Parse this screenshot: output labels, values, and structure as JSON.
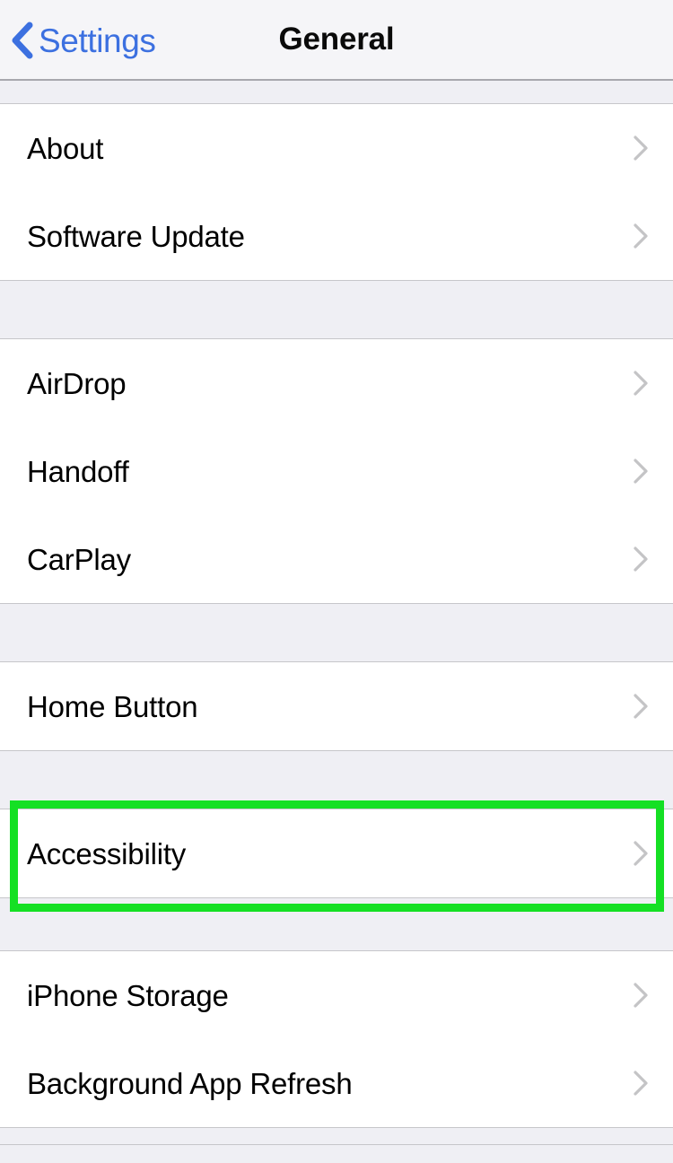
{
  "navbar": {
    "back_label": "Settings",
    "back_icon": "chevron-left-icon",
    "title": "General"
  },
  "colors": {
    "accent_blue": "#3C70E0",
    "highlight_green": "#15E024",
    "group_background": "#FFFFFF",
    "page_background": "#EFEFF4",
    "separator": "#C6C6CA",
    "chevron_gray": "#C4C4C6",
    "label_black": "#000000"
  },
  "sections": [
    {
      "gap_height": 26,
      "first": true,
      "rows": [
        {
          "label": "About",
          "accessory": "chevron-right-icon",
          "highlighted": false
        },
        {
          "label": "Software Update",
          "accessory": "chevron-right-icon",
          "highlighted": false
        }
      ]
    },
    {
      "gap_height": 66,
      "first": false,
      "rows": [
        {
          "label": "AirDrop",
          "accessory": "chevron-right-icon",
          "highlighted": false
        },
        {
          "label": "Handoff",
          "accessory": "chevron-right-icon",
          "highlighted": false
        },
        {
          "label": "CarPlay",
          "accessory": "chevron-right-icon",
          "highlighted": false
        }
      ]
    },
    {
      "gap_height": 66,
      "first": false,
      "rows": [
        {
          "label": "Home Button",
          "accessory": "chevron-right-icon",
          "highlighted": false
        }
      ]
    },
    {
      "gap_height": 66,
      "first": false,
      "rows": [
        {
          "label": "Accessibility",
          "accessory": "chevron-right-icon",
          "highlighted": true
        }
      ]
    },
    {
      "gap_height": 60,
      "first": false,
      "rows": [
        {
          "label": "iPhone Storage",
          "accessory": "chevron-right-icon",
          "highlighted": false
        },
        {
          "label": "Background App Refresh",
          "accessory": "chevron-right-icon",
          "highlighted": false
        }
      ]
    }
  ],
  "footer": {
    "gap_height": 20
  }
}
